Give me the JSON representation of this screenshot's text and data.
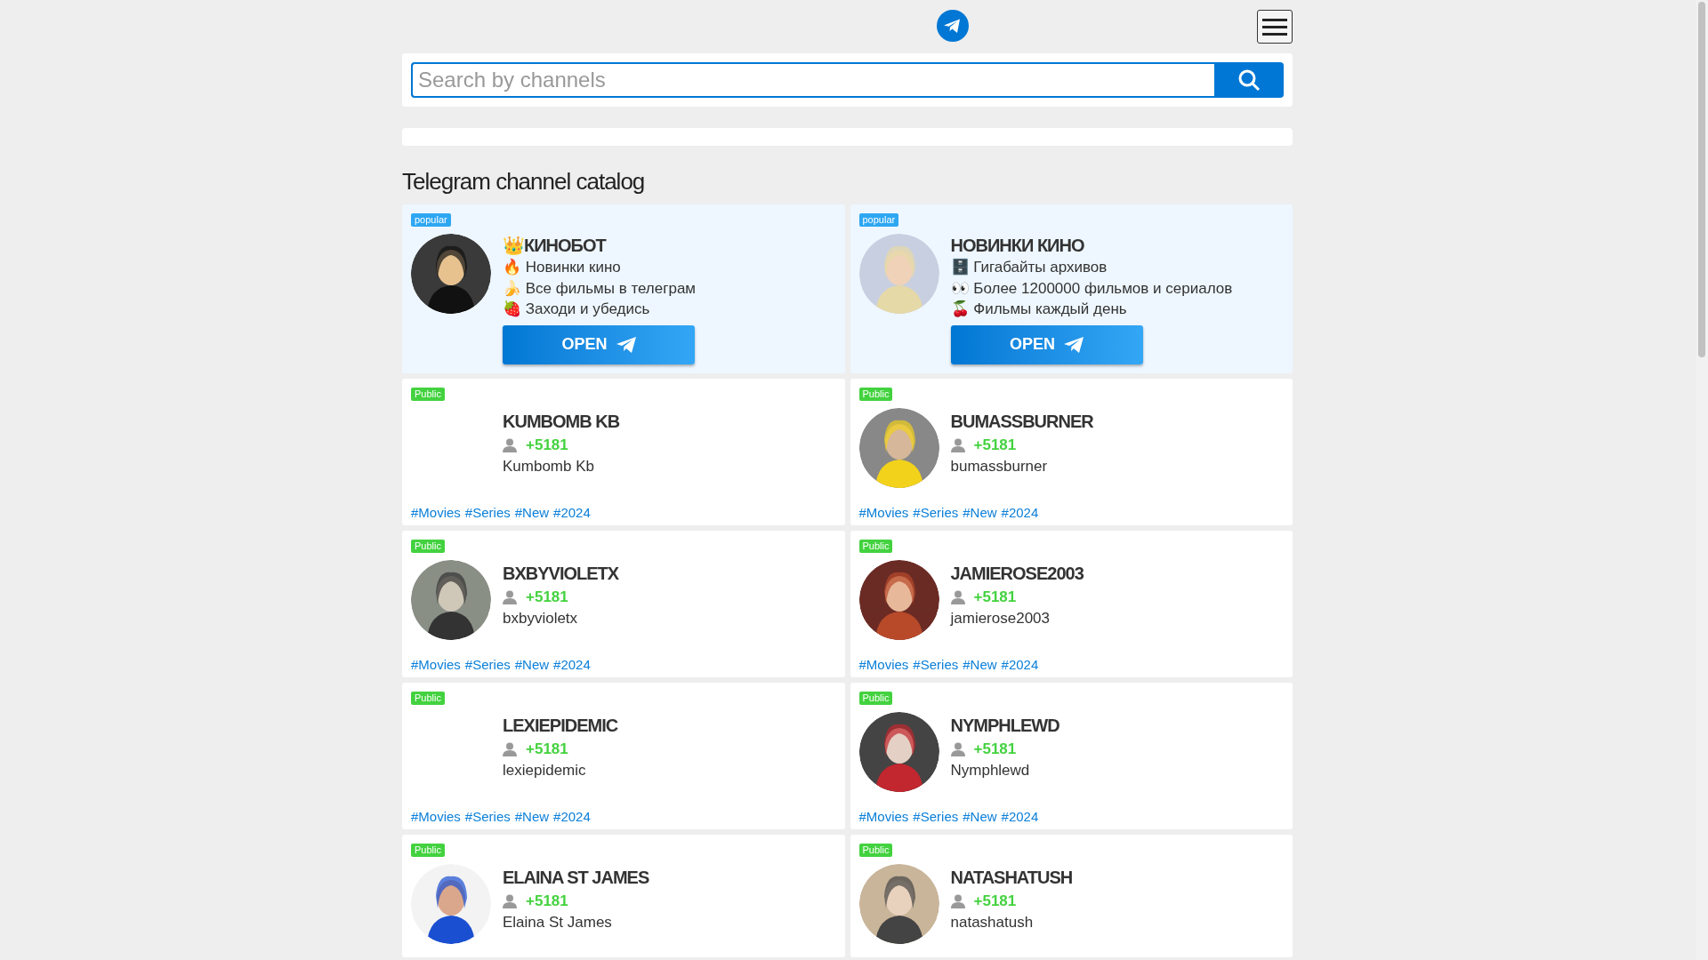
{
  "search": {
    "placeholder": "Search by channels"
  },
  "heading": "Telegram channel catalog",
  "cards": [
    {
      "kind": "featured",
      "badge": "popular",
      "photo": true,
      "title": "👑КИНОБОТ",
      "lines": [
        "🔥 Новинки кино",
        "🍌 Все фильмы в телеграм",
        "🍓 Заходи и убедись"
      ],
      "button": "OPEN"
    },
    {
      "kind": "featured",
      "badge": "popular",
      "photo": true,
      "title": "НОВИНКИ КИНО",
      "lines": [
        "🗄️ Гигабайты архивов",
        "👀 Более 1200000 фильмов и сериалов",
        "🍒 Фильмы каждый день"
      ],
      "button": "OPEN"
    },
    {
      "kind": "public",
      "badge": "Public",
      "photo": false,
      "title": "KUMBOMB KB",
      "count": "+5181",
      "username": "Kumbomb Kb",
      "tags": [
        "#Movies",
        "#Series",
        "#New",
        "#2024"
      ]
    },
    {
      "kind": "public",
      "badge": "Public",
      "photo": true,
      "title": "BUMASSBURNER",
      "count": "+5181",
      "username": "bumassburner",
      "tags": [
        "#Movies",
        "#Series",
        "#New",
        "#2024"
      ]
    },
    {
      "kind": "public",
      "badge": "Public",
      "photo": true,
      "title": "BXBYVIOLETX",
      "count": "+5181",
      "username": "bxbyvioletx",
      "tags": [
        "#Movies",
        "#Series",
        "#New",
        "#2024"
      ]
    },
    {
      "kind": "public",
      "badge": "Public",
      "photo": true,
      "title": "JAMIEROSE2003",
      "count": "+5181",
      "username": "jamierose2003",
      "tags": [
        "#Movies",
        "#Series",
        "#New",
        "#2024"
      ]
    },
    {
      "kind": "public",
      "badge": "Public",
      "photo": false,
      "title": "LEXIEPIDEMIC",
      "count": "+5181",
      "username": "lexiepidemic",
      "tags": [
        "#Movies",
        "#Series",
        "#New",
        "#2024"
      ]
    },
    {
      "kind": "public",
      "badge": "Public",
      "photo": true,
      "title": "NYMPHLEWD",
      "count": "+5181",
      "username": "Nymphlewd",
      "tags": [
        "#Movies",
        "#Series",
        "#New",
        "#2024"
      ]
    },
    {
      "kind": "public",
      "badge": "Public",
      "photo": true,
      "title": "ELAINA ST JAMES",
      "count": "+5181",
      "username": "Elaina St James"
    },
    {
      "kind": "public",
      "badge": "Public",
      "photo": true,
      "title": "NATASHATUSH",
      "count": "+5181",
      "username": "natashatush"
    }
  ]
}
